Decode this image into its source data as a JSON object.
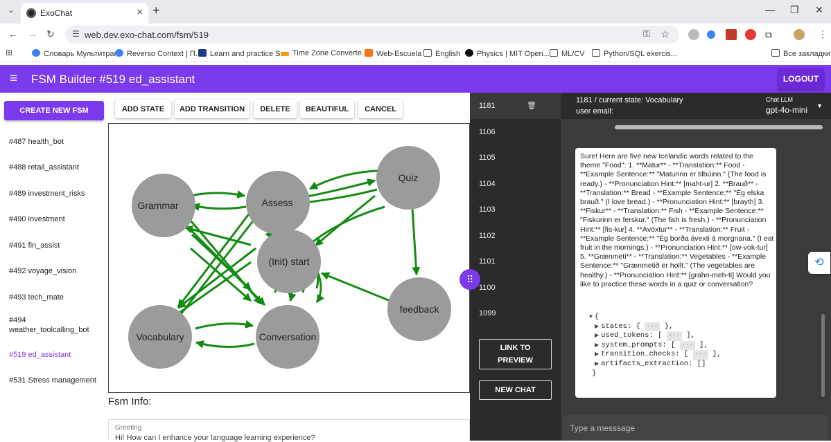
{
  "browser": {
    "tab_title": "ExoChat",
    "url": "web.dev.exo-chat.com/fsm/519",
    "bookmarks": [
      "Словарь Мультитран",
      "Reverso Context | П...",
      "Learn and practice S...",
      "Time Zone Converte...",
      "Web-Escuela",
      "English",
      "Physics | MIT Open...",
      "ML/CV",
      "Python/SQL exercis..."
    ],
    "all_bookmarks": "Все закладки"
  },
  "appbar": {
    "title": "FSM Builder #519 ed_assistant",
    "logout": "LOGOUT"
  },
  "sidebar": {
    "create": "CREATE NEW FSM",
    "items": [
      "#487 health_bot",
      "#488 retail_assistant",
      "#489 investment_risks",
      "#490 investment",
      "#491 fin_assist",
      "#492 voyage_vision",
      "#493 tech_mate",
      "#494 weather_toolcalling_bot",
      "#519 ed_assistant",
      "#531 Stress management"
    ]
  },
  "toolbar": {
    "add_state": "ADD STATE",
    "add_transition": "ADD TRANSITION",
    "delete": "DELETE",
    "beautiful": "BEAUTIFUL",
    "cancel": "CANCEL"
  },
  "graph": {
    "nodes": [
      "Grammar",
      "Assess",
      "Quiz",
      "(Init) start",
      "feedback",
      "Vocabulary",
      "Conversation"
    ]
  },
  "fsm_info": {
    "heading": "Fsm Info:",
    "greeting_label": "Greeting",
    "greeting_value": "Hi! How can I enhance your language learning experience?"
  },
  "chats": {
    "ids": [
      "1181",
      "1106",
      "1105",
      "1104",
      "1103",
      "1102",
      "1101",
      "1100",
      "1099"
    ],
    "link_preview": "LINK TO PREVIEW",
    "new_chat": "NEW CHAT"
  },
  "chat": {
    "state": "1181 / current state: Vocabulary",
    "email": "user email:",
    "llm_label": "Chat LLM",
    "llm_value": "gpt-4o-mini",
    "message": "Sure! Here are five new Icelandic words related to the theme \"Food\": 1. **Matur** - **Translation:** Food - **Example Sentence:** \"Maturinn er tilbúinn.\" (The food is ready.) - **Pronunciation Hint:** [maht-ur] 2. **Brauð** - **Translation:** Bread - **Example Sentence:** \"Ég elska brauð.\" (I love bread.) - **Pronunciation Hint:** [brayth] 3. **Fiskur** - **Translation:** Fish - **Example Sentence:** \"Fiskurinn er ferskur.\" (The fish is fresh.) - **Pronunciation Hint:** [fis-kur] 4. **Ávöxtur** - **Translation:** Fruit - **Example Sentence:** \"Ég borða ávexti á morgnana.\" (I eat fruit in the mornings.) - **Pronunciation Hint:** [ow-vok-tur] 5. **Grænmeti** - **Translation:** Vegetables - **Example Sentence:** \"Grænmetið er hollt.\" (The vegetables are healthy.) - **Pronunciation Hint:** [grahn-meh-ti] Would you like to practice these words in a quiz or conversation?",
    "json": {
      "open": "{",
      "rows": [
        {
          "key": "states: {",
          "close": "},"
        },
        {
          "key": "used_tokens: [",
          "close": "],"
        },
        {
          "key": "system_prompts: [",
          "close": "],"
        },
        {
          "key": "transition_checks: [",
          "close": "],"
        },
        {
          "key": "artifacts_extraction: []",
          "close": ""
        }
      ],
      "dots": "···",
      "end": "}"
    },
    "placeholder": "Type a messsage"
  }
}
